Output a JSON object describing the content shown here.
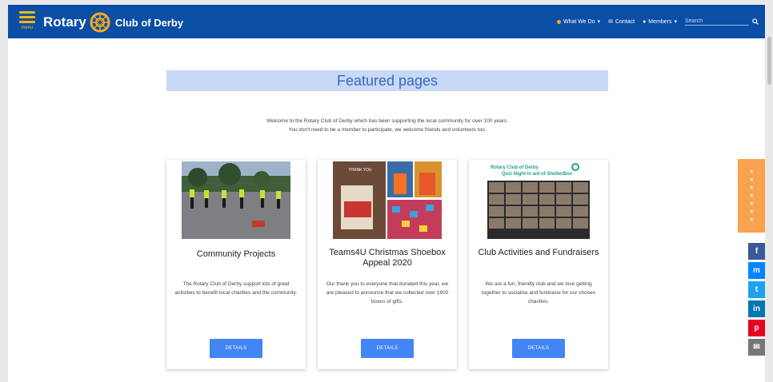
{
  "header": {
    "menu_label": "menu",
    "brand_rotary": "Rotary",
    "brand_club": "Club of Derby",
    "nav": [
      {
        "label": "What We Do",
        "icon": "info-icon"
      },
      {
        "label": "Contact",
        "icon": "envelope-icon"
      },
      {
        "label": "Members",
        "icon": "users-icon"
      }
    ],
    "search_placeholder": "Search"
  },
  "main": {
    "featured_title": "Featured pages",
    "welcome_line1": "Welcome to the Rotary Club of Derby which has been supporting the local community for over 100 years.",
    "welcome_line2": "You don't need to be a member to participate, we welcome friends and volunteers too."
  },
  "cards": [
    {
      "title": "Community Projects",
      "description": "The Rotary Club of Derby support lots of great activities to benefit local charities and the community.",
      "button": "DETAILS"
    },
    {
      "title": "Teams4U Christmas Shoebox Appeal 2020",
      "description": "Our thank you to everyone that donated this year, we are pleased to announce that we collected over 1600 boxes of gifts.",
      "button": "DETAILS",
      "image_text": "THANK YOU"
    },
    {
      "title": "Club Activities and Fundraisers",
      "description": "We are a fun, friendly club and we love getting together to socialise and fundraise for our chosen charities.",
      "button": "DETAILS",
      "image_text_1": "Rotary Club of Derby",
      "image_text_2": "Quiz Night in aid of ShelterBox"
    }
  ],
  "share": [
    {
      "name": "facebook",
      "glyph": "f",
      "color": "#3b5998"
    },
    {
      "name": "messenger",
      "glyph": "m",
      "color": "#0084ff"
    },
    {
      "name": "twitter",
      "glyph": "t",
      "color": "#1da1f2"
    },
    {
      "name": "linkedin",
      "glyph": "in",
      "color": "#0077b5"
    },
    {
      "name": "pinterest",
      "glyph": "p",
      "color": "#e60023"
    },
    {
      "name": "email",
      "glyph": "✉",
      "color": "#777777"
    }
  ],
  "colors": {
    "header_bg": "#0a4ea6",
    "rotary_gold": "#f7a81b",
    "button_blue": "#4285f4",
    "featured_bg": "#c8d9f7",
    "orange_tab": "#f9a34f"
  }
}
